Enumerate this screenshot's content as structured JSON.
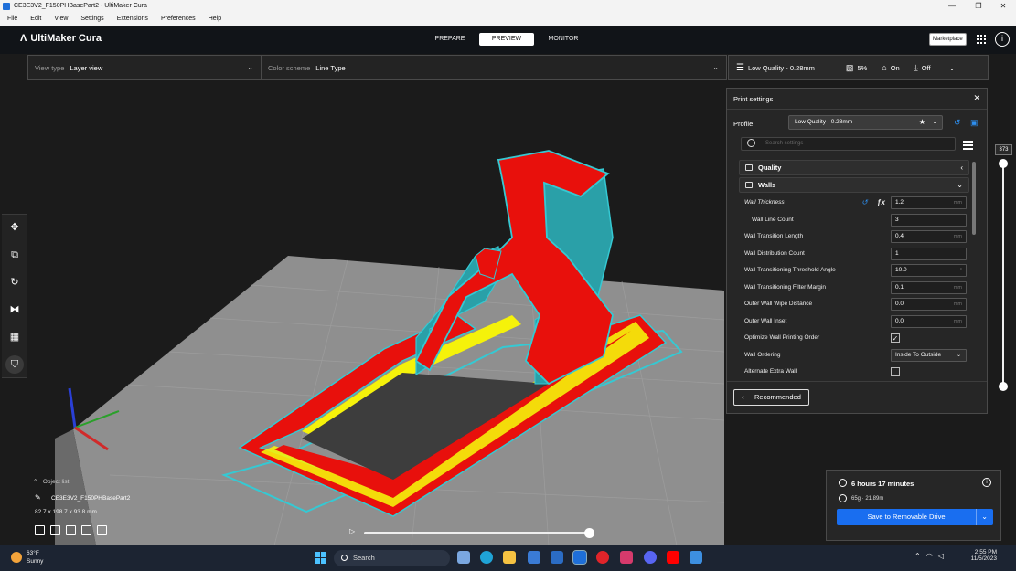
{
  "window": {
    "title": "CE3E3V2_F150PHBasePart2 - UltiMaker Cura"
  },
  "menu": [
    "File",
    "Edit",
    "View",
    "Settings",
    "Extensions",
    "Preferences",
    "Help"
  ],
  "header": {
    "logo": "UltiMaker Cura",
    "stages": [
      "PREPARE",
      "PREVIEW",
      "MONITOR"
    ],
    "active_stage": "PREVIEW",
    "marketplace": "Marketplace"
  },
  "view_selector": {
    "view_type_label": "View type",
    "view_type_value": "Layer view",
    "color_scheme_label": "Color scheme",
    "color_scheme_value": "Line Type"
  },
  "summary": {
    "profile": "Low Quality - 0.28mm",
    "infill": "5%",
    "support": "On",
    "adhesion": "Off"
  },
  "print_settings": {
    "title": "Print settings",
    "profile_label": "Profile",
    "profile_value": "Low Quality - 0.28mm",
    "search_placeholder": "Search settings",
    "categories": {
      "quality": "Quality",
      "walls": "Walls"
    },
    "rows": [
      {
        "label": "Wall Thickness",
        "value": "1.2",
        "unit": "mm"
      },
      {
        "label": "Wall Line Count",
        "value": "3",
        "unit": ""
      },
      {
        "label": "Wall Transition Length",
        "value": "0.4",
        "unit": "mm"
      },
      {
        "label": "Wall Distribution Count",
        "value": "1",
        "unit": ""
      },
      {
        "label": "Wall Transitioning Threshold Angle",
        "value": "10.0",
        "unit": "°"
      },
      {
        "label": "Wall Transitioning Filter Margin",
        "value": "0.1",
        "unit": "mm"
      },
      {
        "label": "Outer Wall Wipe Distance",
        "value": "0.0",
        "unit": "mm"
      },
      {
        "label": "Outer Wall Inset",
        "value": "0.0",
        "unit": "mm"
      },
      {
        "label": "Optimize Wall Printing Order",
        "checked": "✓"
      },
      {
        "label": "Wall Ordering",
        "value": "Inside To Outside"
      },
      {
        "label": "Alternate Extra Wall",
        "checked": ""
      }
    ],
    "recommended": "Recommended"
  },
  "layer_slider": {
    "value": "373",
    "level": 1.0
  },
  "object_list": {
    "header": "Object list",
    "object_name": "CE3E3V2_F150PHBasePart2",
    "dimensions": "82.7 x 198.7 x 93.8 mm"
  },
  "estimate": {
    "time": "6 hours 17 minutes",
    "material": "65g · 21.89m",
    "save_button": "Save to Removable Drive"
  },
  "taskbar": {
    "weather_temp": "63°F",
    "weather_cond": "Sunny",
    "search": "Search",
    "time": "2:55 PM",
    "date": "11/5/2023"
  },
  "colors": {
    "accent": "#196ef0",
    "wall_outer": "#e8100c",
    "wall_inner": "#f5f20a",
    "support": "#35c9d3",
    "bed": "#8e8e8e"
  }
}
